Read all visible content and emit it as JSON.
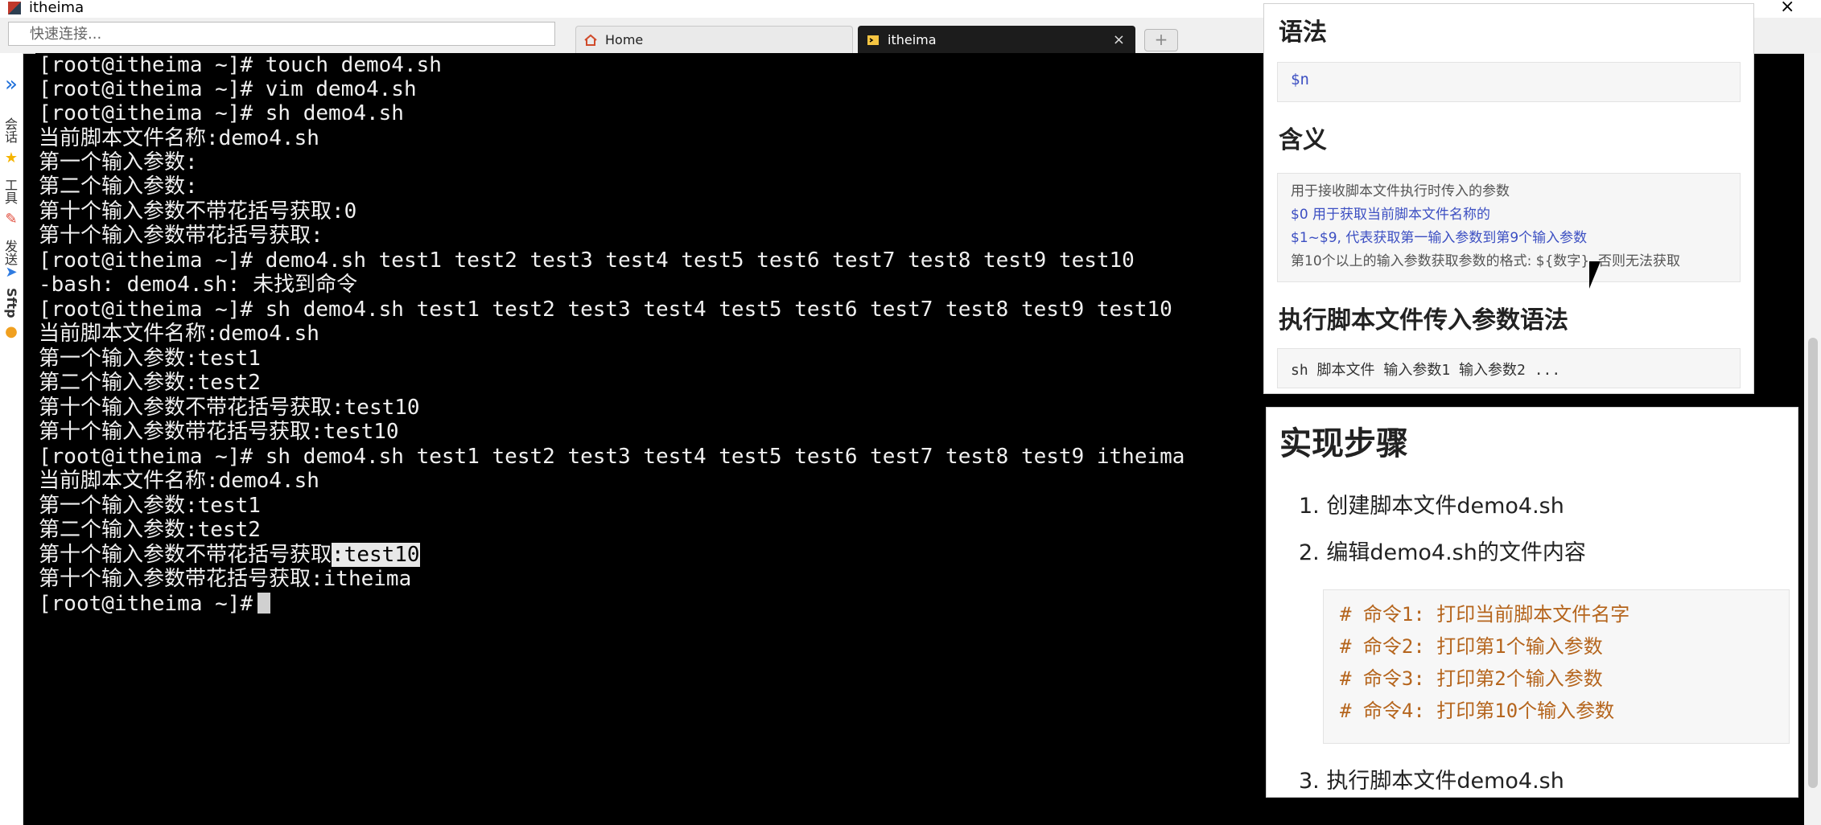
{
  "window": {
    "title": "itheima"
  },
  "tabstrip": {
    "quick_placeholder": "快速连接...",
    "tabs": [
      {
        "label": "Home"
      },
      {
        "label": "itheima"
      }
    ],
    "new_tab_symbol": "+"
  },
  "rail": {
    "expand_symbol": "»",
    "items": [
      "会话",
      "工具",
      "发送",
      "Sftp"
    ]
  },
  "terminal": {
    "lines": [
      "[root@itheima ~]# touch demo4.sh",
      "[root@itheima ~]# vim demo4.sh",
      "[root@itheima ~]# sh demo4.sh",
      "当前脚本文件名称:demo4.sh",
      "第一个输入参数:",
      "第二个输入参数:",
      "第十个输入参数不带花括号获取:0",
      "第十个输入参数带花括号获取:",
      "[root@itheima ~]# demo4.sh test1 test2 test3 test4 test5 test6 test7 test8 test9 test10",
      "-bash: demo4.sh: 未找到命令",
      "[root@itheima ~]# sh demo4.sh test1 test2 test3 test4 test5 test6 test7 test8 test9 test10",
      "当前脚本文件名称:demo4.sh",
      "第一个输入参数:test1",
      "第二个输入参数:test2",
      "第十个输入参数不带花括号获取:test10",
      "第十个输入参数带花括号获取:test10",
      "[root@itheima ~]# sh demo4.sh test1 test2 test3 test4 test5 test6 test7 test8 test9 itheima",
      "当前脚本文件名称:demo4.sh",
      "第一个输入参数:test1",
      "第二个输入参数:test2",
      "第十个输入参数不带花括号获取",
      "第十个输入参数带花括号获取:itheima",
      "[root@itheima ~]#"
    ],
    "highlight": ":test10"
  },
  "doc_top": {
    "syntax_heading": "语法",
    "syntax_code": "$n",
    "meaning_heading": "含义",
    "meaning_lines": [
      "用于接收脚本文件执行时传入的参数",
      "$0 用于获取当前脚本文件名称的",
      "$1~$9, 代表获取第一输入参数到第9个输入参数",
      "第10个以上的输入参数获取参数的格式: ${数字}, 否则无法获取"
    ],
    "exec_heading": "执行脚本文件传入参数语法",
    "exec_code": "sh 脚本文件 输入参数1 输入参数2 ..."
  },
  "doc_bottom": {
    "heading": "实现步骤",
    "step1": "1. 创建脚本文件demo4.sh",
    "step2": "2. 编辑demo4.sh的文件内容",
    "comments": [
      "# 命令1: 打印当前脚本文件名字",
      "# 命令2: 打印第1个输入参数",
      "# 命令3: 打印第2个输入参数",
      "# 命令4: 打印第10个输入参数"
    ],
    "step3": "3. 执行脚本文件demo4.sh"
  }
}
